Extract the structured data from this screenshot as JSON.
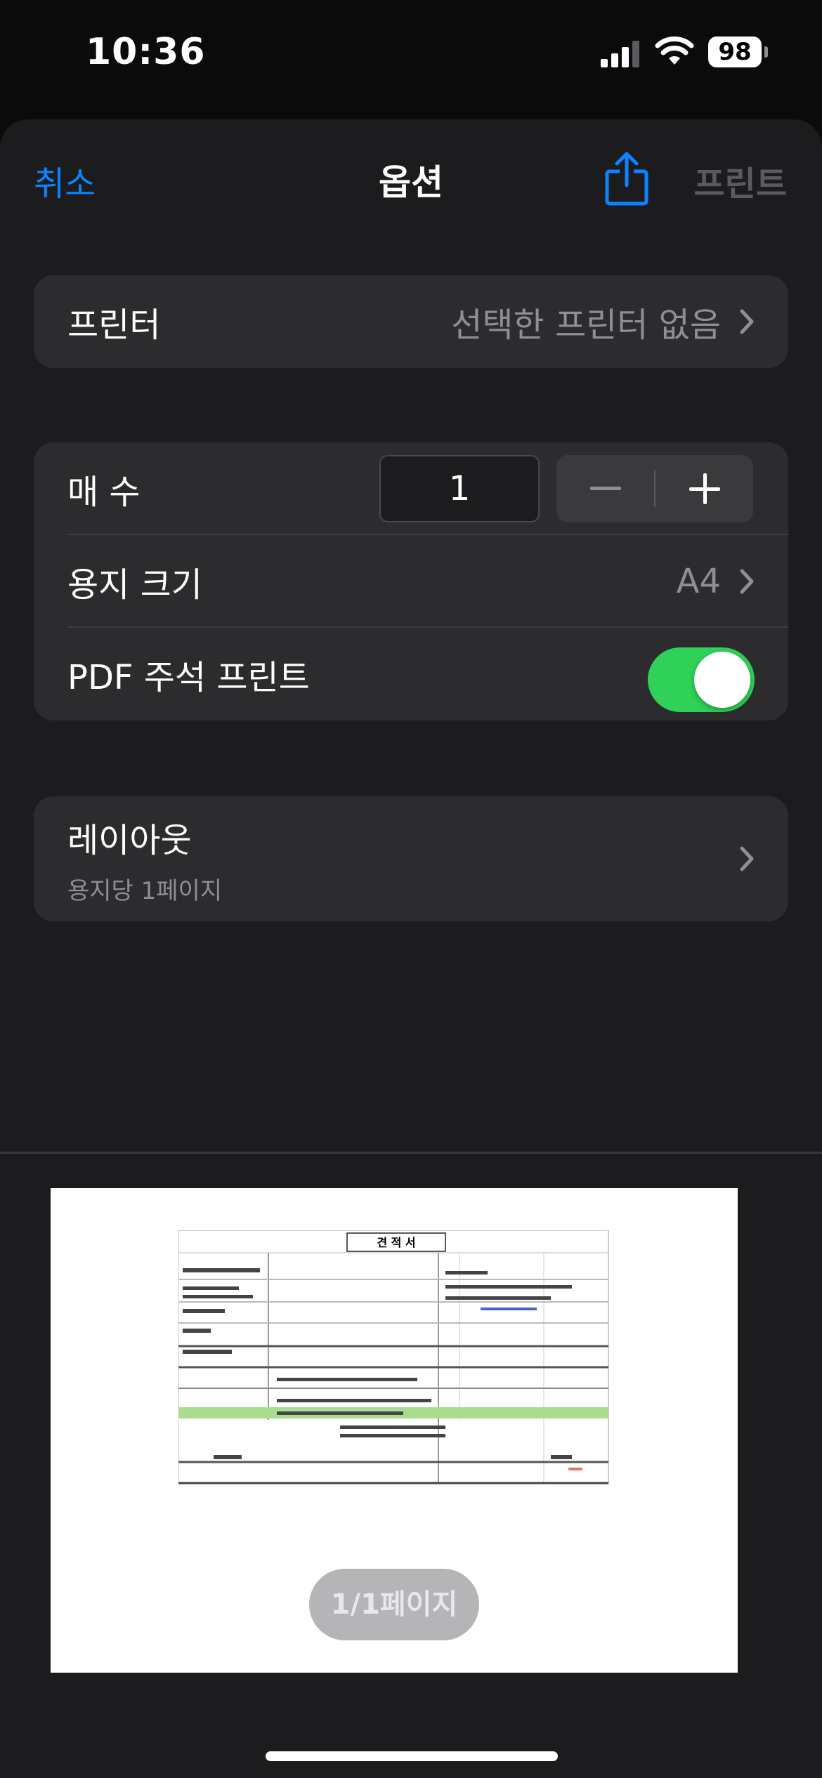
{
  "status_bar": {
    "time": "10:36",
    "battery_level": "98",
    "icons": [
      "signal-icon",
      "wifi-icon",
      "battery-icon"
    ]
  },
  "nav": {
    "cancel_label": "취소",
    "title": "옵션",
    "print_label": "프린트",
    "share_icon": "share-icon"
  },
  "printer": {
    "label": "프린터",
    "value": "선택한 프린터 없음"
  },
  "copies": {
    "label": "매 수",
    "value": "1",
    "minus_icon": "minus-icon",
    "plus_icon": "plus-icon"
  },
  "paper_size": {
    "label": "용지 크기",
    "value": "A4"
  },
  "pdf_annotations": {
    "label": "PDF 주석 프린트",
    "enabled": true
  },
  "layout": {
    "title": "레이아웃",
    "subtitle": "용지당 1페이지"
  },
  "preview": {
    "doc_title": "견 적 서",
    "page_indicator": "1/1페이지"
  },
  "colors": {
    "accent": "#0a84ff",
    "toggle_on": "#30d158",
    "sheet_bg": "#1c1c1e",
    "group_bg": "#2c2c2e"
  }
}
